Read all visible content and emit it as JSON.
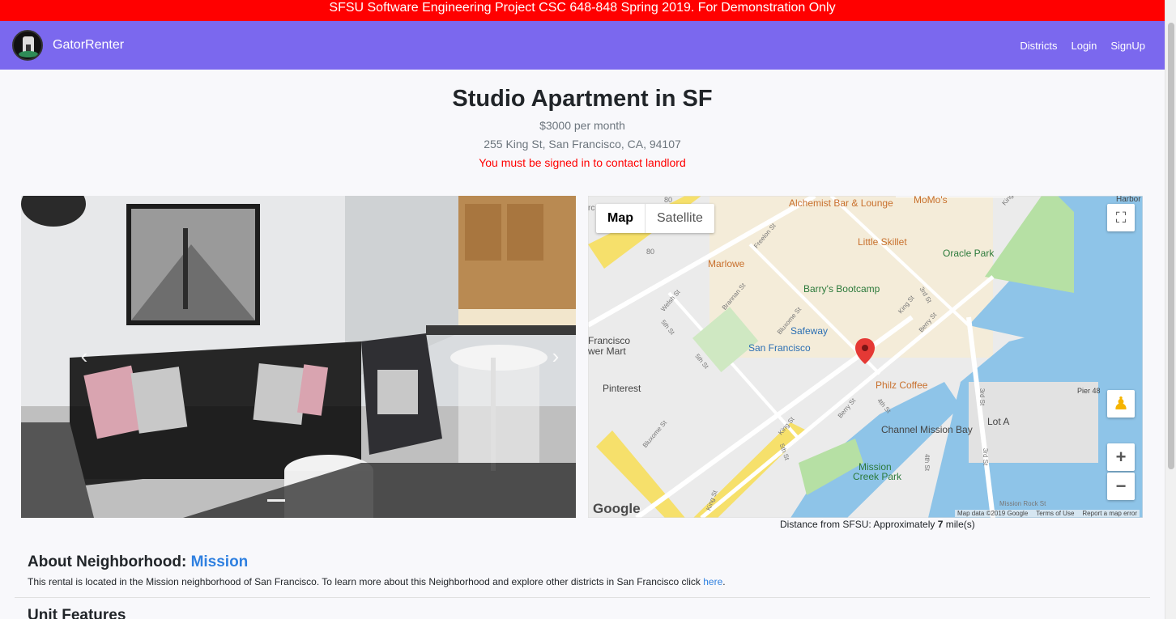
{
  "banner": "SFSU Software Engineering Project CSC 648-848 Spring 2019. For Demonstration Only",
  "navbar": {
    "brand": "GatorRenter",
    "links": [
      "Districts",
      "Login",
      "SignUp"
    ]
  },
  "listing": {
    "title": "Studio Apartment in SF",
    "price": "$3000 per month",
    "address": "255 King St, San Francisco, CA, 94107",
    "contact_warning": "You must be signed in to contact landlord"
  },
  "carousel": {
    "prev_icon": "chevron-left-icon",
    "next_icon": "chevron-right-icon",
    "prev_glyph": "‹",
    "next_glyph": "›"
  },
  "map": {
    "tab_map": "Map",
    "tab_satellite": "Satellite",
    "fullscreen_glyph": "⛶",
    "zoom_in_glyph": "+",
    "zoom_out_glyph": "−",
    "pegman_glyph": "♟",
    "google": "Google",
    "footer": [
      "Map data ©2019 Google",
      "Terms of Use",
      "Report a map error"
    ],
    "places": {
      "alchemist": "Alchemist Bar & Lounge",
      "momos": "MoMo's",
      "harbor": "Harbor",
      "little_skillet": "Little Skillet",
      "oracle_park": "Oracle Park",
      "marlowe": "Marlowe",
      "barrys": "Barry's Bootcamp",
      "safeway": "Safeway",
      "sf_station": "San Francisco",
      "flower_mart_1": "Francisco",
      "flower_mart_2": "wer Mart",
      "philz": "Philz Coffee",
      "pinterest": "Pinterest",
      "pier48": "Pier 48",
      "lot_a": "Lot A",
      "channel_mission_bay": "Channel Mission Bay",
      "mission_creek_1": "Mission",
      "mission_creek_2": "Creek Park",
      "mission_rock": "Mission Rock St"
    },
    "streets": {
      "freelon": "Freelon St",
      "brannan": "Brannan St",
      "welsh": "Welsh St",
      "fifth_a": "5th St",
      "fifth_b": "5th St",
      "bluxome_a": "Bluxome St",
      "bluxome_b": "Bluxome St",
      "king_a": "King St",
      "king_b": "King St",
      "king_c": "King St",
      "king_d": "King",
      "third_a": "3rd St",
      "third_b": "3rd St",
      "third_c": "3rd St",
      "berry_a": "Berry St",
      "berry_b": "Berry St",
      "fourth_a": "4th St",
      "fourth_b": "4th St",
      "fifth_c": "5th St",
      "i80": "80",
      "i80b": "80",
      "rc": "rc"
    }
  },
  "distance": {
    "prefix": "Distance from SFSU: Approximately ",
    "value": "7",
    "suffix": " mile(s)"
  },
  "about": {
    "heading": "About Neighborhood: ",
    "neighborhood": "Mission",
    "text": "This rental is located in the Mission neighborhood of San Francisco. To learn more about this Neighborhood and explore other districts in San Francisco click ",
    "link": "here",
    "period": "."
  },
  "unit_features": {
    "heading": "Unit Features"
  },
  "colors": {
    "banner": "#ff0000",
    "navbar": "#7b68ee",
    "link": "#2f80e0",
    "warning": "#ff0000"
  }
}
